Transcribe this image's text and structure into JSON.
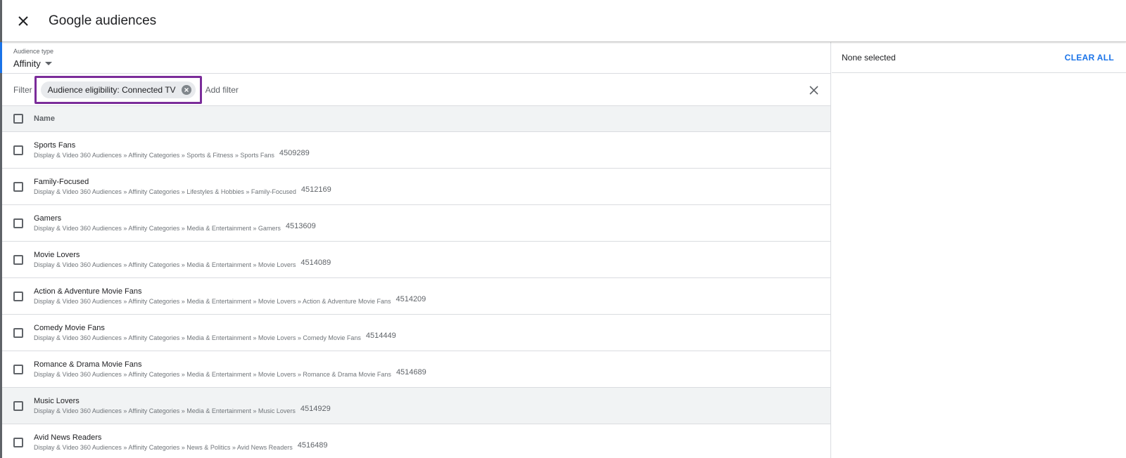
{
  "header": {
    "title": "Google audiences",
    "close_icon": "close-icon"
  },
  "audience_type": {
    "label": "Audience type",
    "value": "Affinity"
  },
  "filter": {
    "label": "Filter",
    "chip": "Audience eligibility: Connected TV",
    "add_filter": "Add filter"
  },
  "table": {
    "column_name": "Name",
    "rows": [
      {
        "name": "Sports Fans",
        "path": "Display & Video 360 Audiences » Affinity Categories » Sports & Fitness » Sports Fans",
        "id": "4509289"
      },
      {
        "name": "Family-Focused",
        "path": "Display & Video 360 Audiences » Affinity Categories » Lifestyles & Hobbies » Family-Focused",
        "id": "4512169"
      },
      {
        "name": "Gamers",
        "path": "Display & Video 360 Audiences » Affinity Categories » Media & Entertainment » Gamers",
        "id": "4513609"
      },
      {
        "name": "Movie Lovers",
        "path": "Display & Video 360 Audiences » Affinity Categories » Media & Entertainment » Movie Lovers",
        "id": "4514089"
      },
      {
        "name": "Action & Adventure Movie Fans",
        "path": "Display & Video 360 Audiences » Affinity Categories » Media & Entertainment » Movie Lovers » Action & Adventure Movie Fans",
        "id": "4514209"
      },
      {
        "name": "Comedy Movie Fans",
        "path": "Display & Video 360 Audiences » Affinity Categories » Media & Entertainment » Movie Lovers » Comedy Movie Fans",
        "id": "4514449"
      },
      {
        "name": "Romance & Drama Movie Fans",
        "path": "Display & Video 360 Audiences » Affinity Categories » Media & Entertainment » Movie Lovers » Romance & Drama Movie Fans",
        "id": "4514689"
      },
      {
        "name": "Music Lovers",
        "path": "Display & Video 360 Audiences » Affinity Categories » Media & Entertainment » Music Lovers",
        "id": "4514929"
      },
      {
        "name": "Avid News Readers",
        "path": "Display & Video 360 Audiences » Affinity Categories » News & Politics » Avid News Readers",
        "id": "4516489"
      }
    ]
  },
  "selection": {
    "status": "None selected",
    "clear_all": "CLEAR ALL"
  },
  "colors": {
    "accent": "#1a73e8",
    "highlight_border": "#7b2c9a"
  }
}
